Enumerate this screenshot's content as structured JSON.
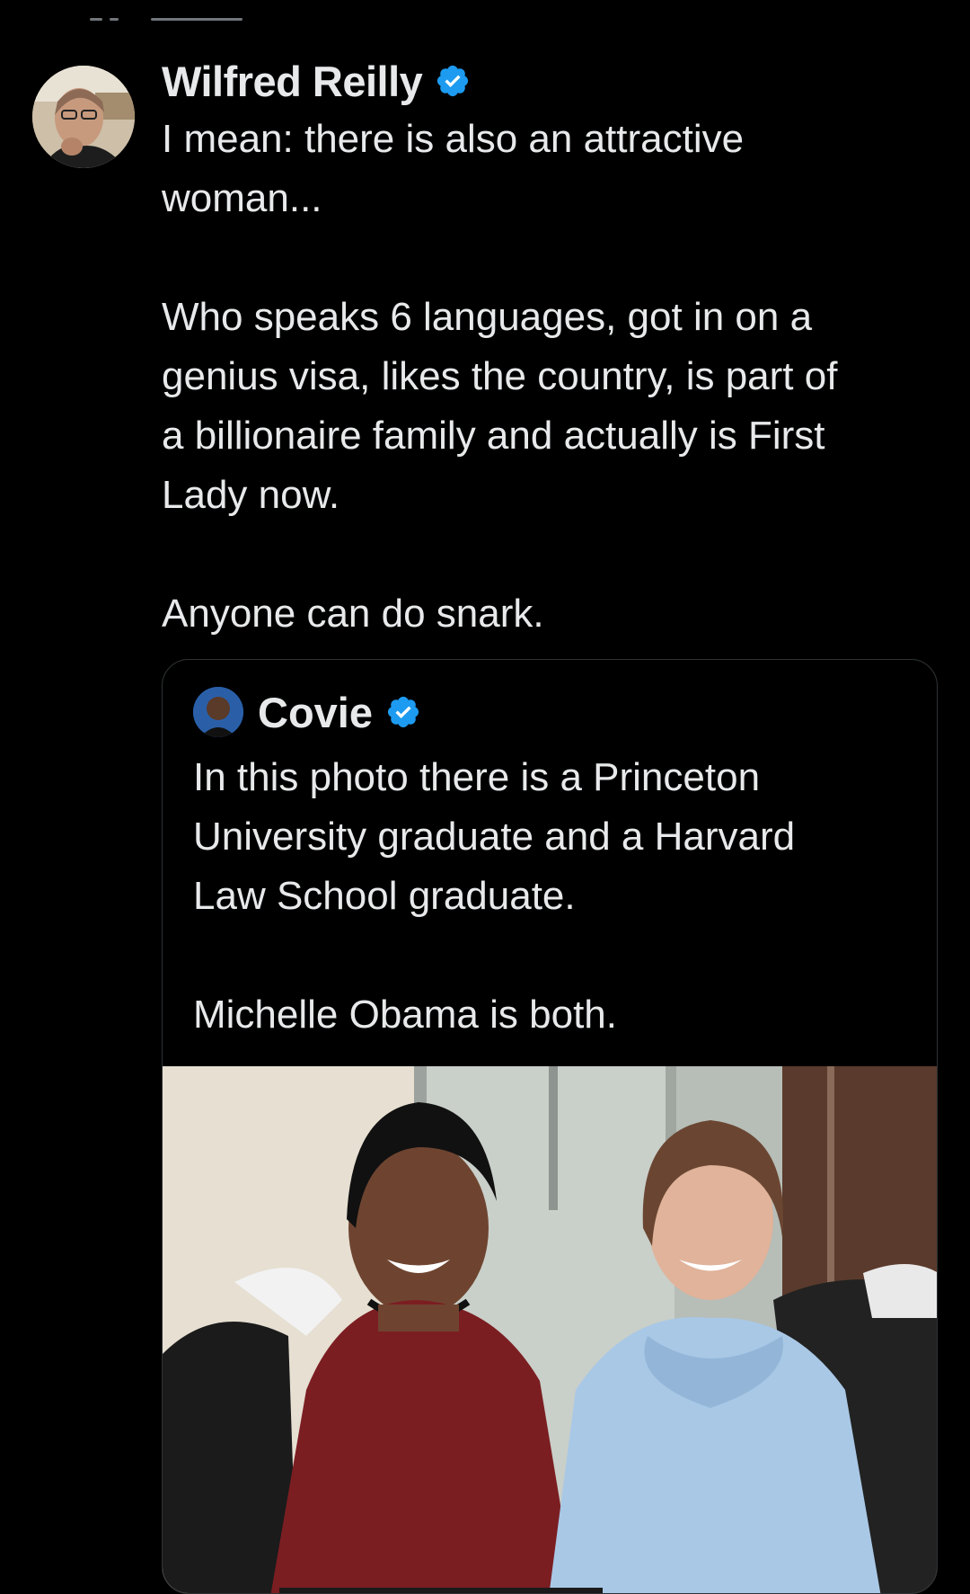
{
  "post": {
    "author": "Wilfred Reilly",
    "verified_icon": "verified-badge-icon",
    "text": "I mean: there is also an attractive\nwoman...\n\nWho speaks 6 languages, got in on a\ngenius visa, likes the country, is part of\na billionaire family and actually is First\nLady now.\n\nAnyone can do snark."
  },
  "quoted_post": {
    "author": "Covie",
    "verified_icon": "verified-badge-icon",
    "text": "In this photo there is a Princeton\nUniversity graduate and a Harvard\nLaw School graduate.\n\nMichelle Obama is both."
  },
  "colors": {
    "background": "#000000",
    "text": "#e7e9ea",
    "verified": "#1d9bf0",
    "border": "#2f3336"
  }
}
